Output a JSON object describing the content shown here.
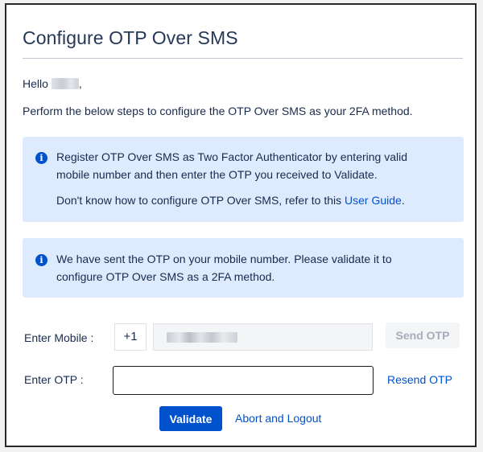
{
  "page": {
    "title": "Configure OTP Over SMS",
    "greeting_prefix": "Hello",
    "greeting_suffix": ",",
    "instructions": "Perform the below steps to configure the OTP Over SMS as your 2FA method."
  },
  "info_register": {
    "icon": "info-icon",
    "line1": "Register OTP Over SMS as Two Factor Authenticator by entering valid mobile number and then enter the OTP you received to Validate.",
    "line2_prefix": "Don't know how to configure OTP Over SMS, refer to this",
    "user_guide_link": "User Guide",
    "line2_suffix": "."
  },
  "info_sent": {
    "icon": "info-icon",
    "text": "We have sent the OTP on your mobile number. Please validate it to configure OTP Over SMS as a 2FA method."
  },
  "form": {
    "mobile_label": "Enter Mobile :",
    "country_code": "+1",
    "send_otp_label": "Send OTP",
    "otp_label": "Enter OTP :",
    "otp_value": "",
    "resend_otp_label": "Resend OTP",
    "validate_label": "Validate",
    "abort_label": "Abort and Logout"
  },
  "colors": {
    "primary": "#0052cc",
    "info_background": "#deebff",
    "disabled_text": "#a5adba"
  }
}
